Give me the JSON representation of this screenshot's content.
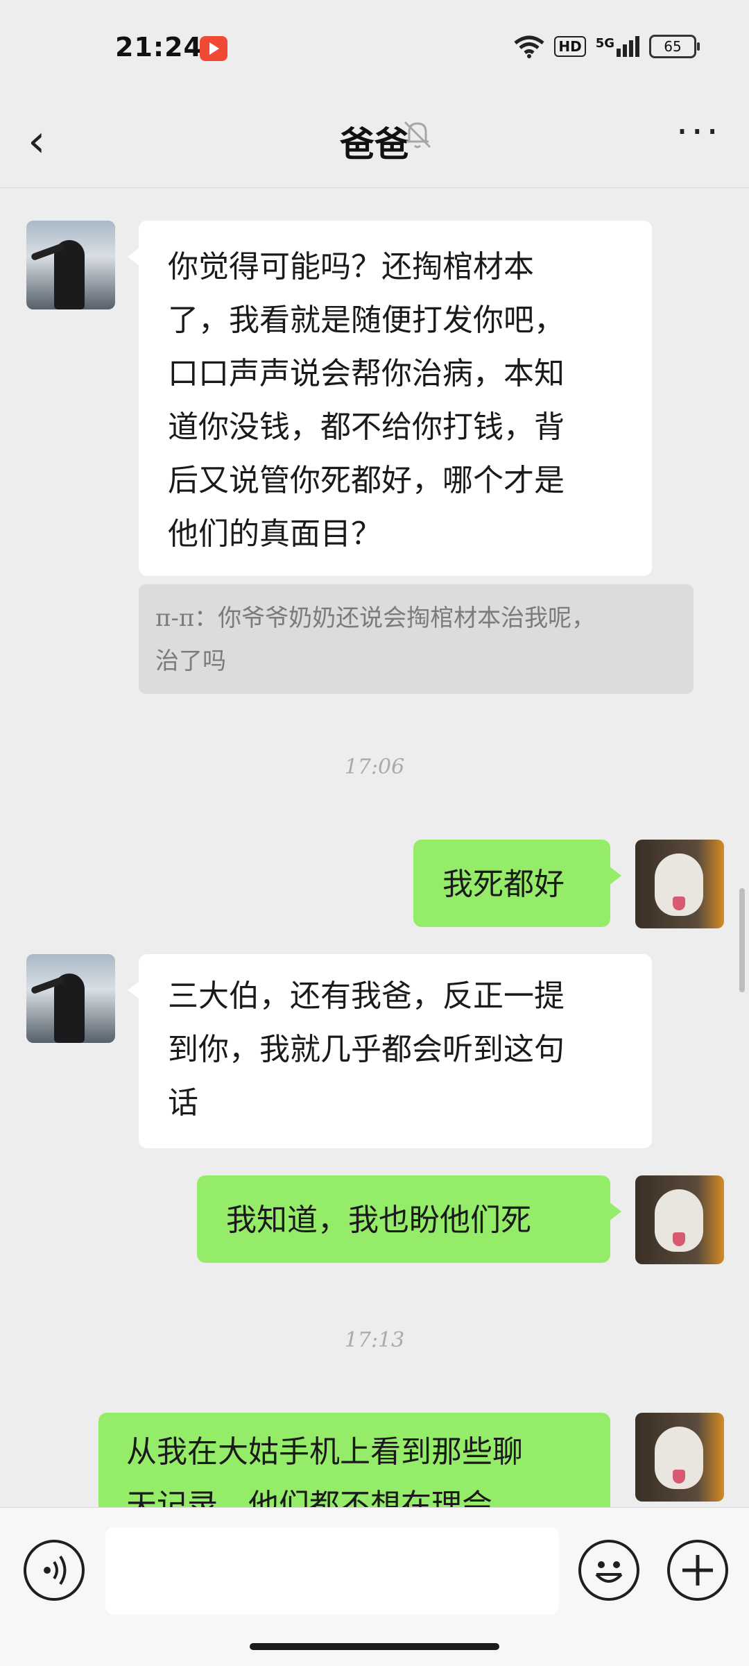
{
  "status_bar": {
    "time": "21:24",
    "hd_badge": "HD",
    "network": "5G",
    "battery": "65"
  },
  "header": {
    "back_glyph": "‹",
    "title": "爸爸",
    "mute_icon": "bell-muted",
    "more_glyph": "···"
  },
  "messages": [
    {
      "side": "incoming",
      "lines": [
        "你觉得可能吗？还掏棺材本",
        "了，我看就是随便打发你吧，",
        "口口声声说会帮你治病，本知",
        "道你没钱，都不给你打钱，背",
        "后又说管你死都好，哪个才是",
        "他们的真面目？"
      ]
    },
    {
      "side": "quote",
      "lines": [
        "π-π：你爷爷奶奶还说会掏棺材本治我呢，",
        "治了吗"
      ]
    },
    {
      "side": "timestamp",
      "text": "17:06"
    },
    {
      "side": "outgoing",
      "lines": [
        "我死都好"
      ]
    },
    {
      "side": "incoming",
      "lines": [
        "三大伯，还有我爸，反正一提",
        "到你，我就几乎都会听到这句",
        "话"
      ]
    },
    {
      "side": "outgoing",
      "lines": [
        "我知道，我也盼他们死"
      ]
    },
    {
      "side": "timestamp",
      "text": "17:13"
    },
    {
      "side": "outgoing",
      "lines": [
        "从我在大姑手机上看到那些聊",
        "天记录，他们都不想在理会"
      ]
    }
  ],
  "input_bar": {
    "voice_glyph": "◗",
    "emoji_glyph": "☺",
    "plus_glyph": "+",
    "placeholder": ""
  }
}
